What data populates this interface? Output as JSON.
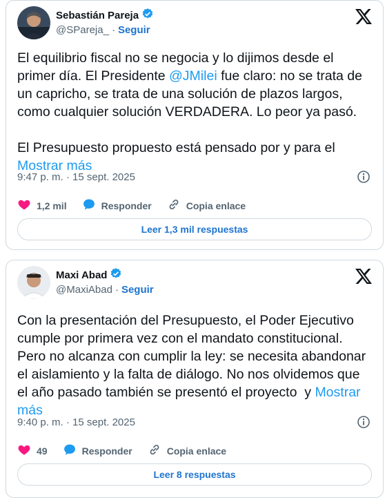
{
  "tweets": [
    {
      "author_name": "Sebastián Pareja",
      "handle": "@SPareja_",
      "separator": "·",
      "follow_label": "Seguir",
      "text_before": "El equilibrio fiscal no se negocia y lo dijimos desde el primer día. El Presidente ",
      "mention": "@JMilei",
      "text_after": " fue claro: no se trata de un capricho, se trata de una solución de plazos largos, como cualquier solución VERDADERA. Lo peor ya pasó.\n\nEl Presupuesto propuesto está pensado por y para el ",
      "show_more": "Mostrar más",
      "timestamp": "9:47 p. m. · 15 sept. 2025",
      "likes": "1,2 mil",
      "reply_label": "Responder",
      "copy_label": "Copia enlace",
      "replies_button": "Leer 1,3 mil respuestas"
    },
    {
      "author_name": "Maxi Abad",
      "handle": "@MaxiAbad",
      "separator": "·",
      "follow_label": "Seguir",
      "text_before": "Con la presentación del Presupuesto, el Poder Ejecutivo cumple por primera vez con el mandato constitucional. Pero no alcanza con cumplir la ley: se necesita abandonar el aislamiento y la falta de diálogo. No nos olvidemos que el año pasado también se presentó el proyecto  y ",
      "mention": "",
      "text_after": "",
      "show_more": "Mostrar más",
      "timestamp": "9:40 p. m. · 15 sept. 2025",
      "likes": "49",
      "reply_label": "Responder",
      "copy_label": "Copia enlace",
      "replies_button": "Leer 8 respuestas"
    }
  ],
  "colors": {
    "accent": "#1d9bf0",
    "follow": "#1d74cf",
    "heart": "#f91880",
    "verified": "#1d9bf0",
    "muted": "#536471",
    "border": "#cfd9de"
  },
  "icons": [
    "verified-badge-icon",
    "x-logo-icon",
    "info-icon",
    "heart-icon",
    "reply-bubble-icon",
    "link-icon"
  ]
}
